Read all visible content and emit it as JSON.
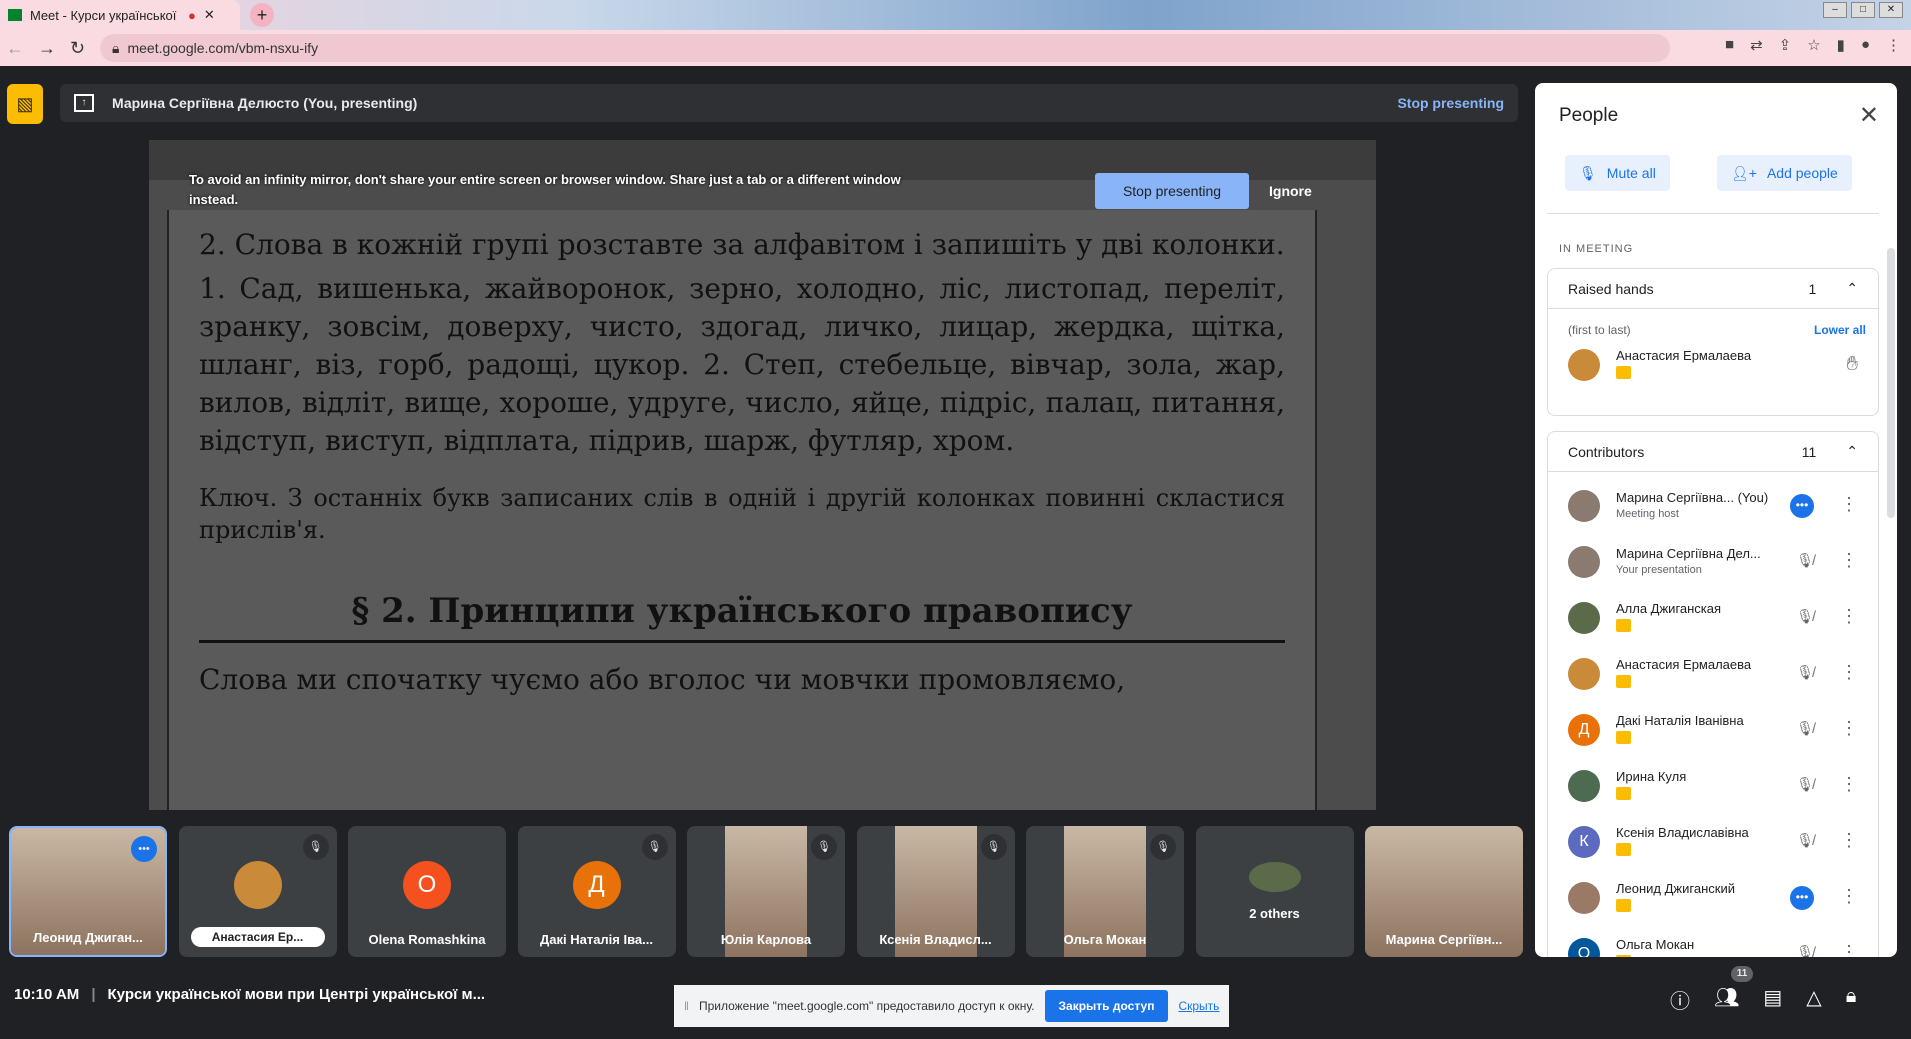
{
  "browser": {
    "tab_title": "Meet - Курси української мо",
    "url": "meet.google.com/vbm-nsxu-ify"
  },
  "banner": {
    "presenter": "Марина Сергіївна Делюсто (You, presenting)",
    "stop": "Stop presenting"
  },
  "warning": {
    "text": "To avoid an infinity mirror, don't share your entire screen or browser window. Share just a tab or a different window instead.",
    "stop": "Stop presenting",
    "ignore": "Ignore"
  },
  "document": {
    "task": "2. Слова в кожній групі розставте за алфавітом і запишіть у дві колонки.",
    "body": "1. Сад, вишенька, жайворонок, зерно, холодно, ліс, листопад, переліт, зранку, зовсім, доверху, чисто, здогад, личко, лицар, жердка, щітка, шланг, віз, горб, радощі, цукор. 2. Степ, стебельце, вівчар, зола, жар, вилов, відліт, вище, хороше, удруге, число, яйце, підріс, палац, питання, відступ, виступ, відплата, підрив, шарж, футляр, хром.",
    "key": "Ключ. З останніх букв записаних слів в одній і другій колонках повинні скластися прислів'я.",
    "heading": "§ 2. Принципи українського правопису",
    "last": "Слова ми спочатку чуємо або вголос чи мовчки промовляємо,"
  },
  "people": {
    "title": "People",
    "mute_all": "Mute all",
    "add_people": "Add people",
    "in_meeting": "IN MEETING",
    "raised": {
      "label": "Raised hands",
      "count": "1",
      "order": "(first to last)",
      "lower_all": "Lower all",
      "person": "Анастасия Ермалаева"
    },
    "contributors": {
      "label": "Contributors",
      "count": "11",
      "items": [
        {
          "name": "Марина Сергіївна... (You)",
          "sub": "Meeting host",
          "color": "#8a7a70",
          "state": "speaking"
        },
        {
          "name": "Марина Сергіївна Дел...",
          "sub": "Your presentation",
          "color": "#8a7a70",
          "state": "muted"
        },
        {
          "name": "Алла Джиганская",
          "sub": "",
          "color": "#5b6b4a",
          "state": "muted"
        },
        {
          "name": "Анастасия Ермалаева",
          "sub": "",
          "color": "#c98a3a",
          "state": "muted"
        },
        {
          "name": "Дакі Наталія Іванівна",
          "sub": "",
          "color": "#e8710a",
          "initial": "Д",
          "state": "muted"
        },
        {
          "name": "Ирина Куля",
          "sub": "",
          "color": "#4d6b50",
          "state": "muted"
        },
        {
          "name": "Ксенія Владиславівна",
          "sub": "",
          "color": "#5c6bc0",
          "initial": "К",
          "state": "muted"
        },
        {
          "name": "Леонид Джиганский",
          "sub": "",
          "color": "#9a7a66",
          "state": "speaking"
        },
        {
          "name": "Ольга Мокан",
          "sub": "",
          "color": "#01579b",
          "initial": "О",
          "state": "muted"
        }
      ]
    }
  },
  "tiles": [
    {
      "name": "Леонид Джиган..."
    },
    {
      "name": "Анастасия Ер..."
    },
    {
      "name": "Olena Romashkina",
      "initial": "O",
      "color": "#f4511e"
    },
    {
      "name": "Дакі Наталія Іва...",
      "initial": "Д",
      "color": "#e8710a"
    },
    {
      "name": "Юлія Карлова"
    },
    {
      "name": "Ксенія Владисл..."
    },
    {
      "name": "Ольга Мокан"
    },
    {
      "name": "2 others"
    },
    {
      "name": "Марина Сергіївн..."
    }
  ],
  "bottom": {
    "time": "10:10 AM",
    "meeting": "Курси української мови при Центрі української м...",
    "people_count": "11"
  },
  "notification": {
    "text": "Приложение \"meet.google.com\" предоставило доступ к окну.",
    "stop": "Закрыть доступ",
    "hide": "Скрыть"
  }
}
